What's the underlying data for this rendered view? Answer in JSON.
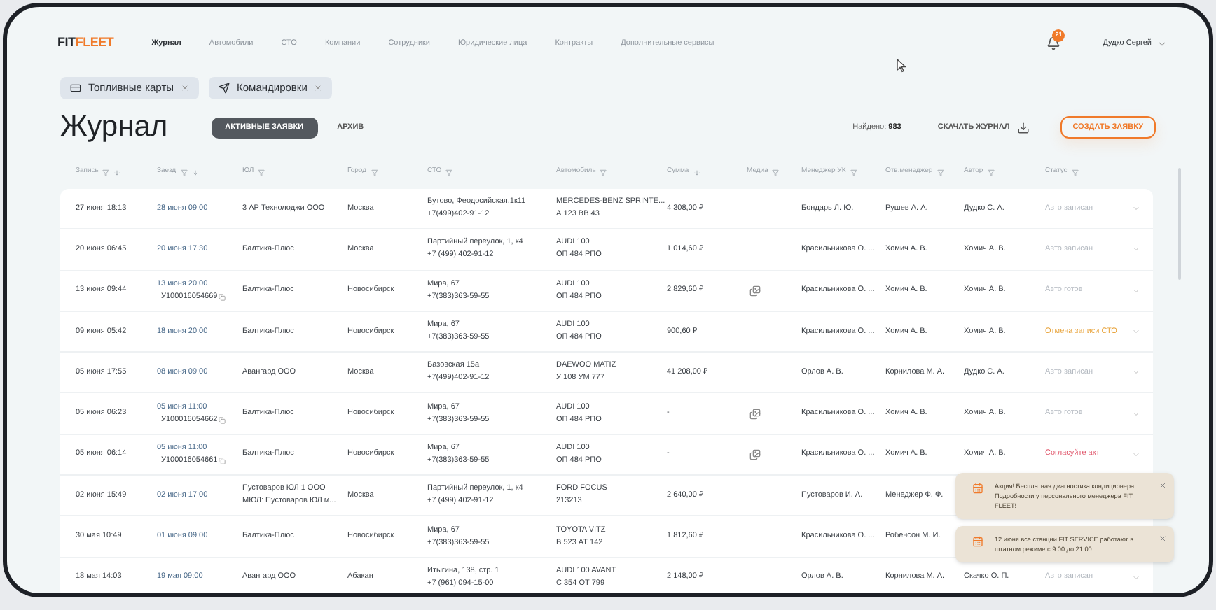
{
  "logo": {
    "part_1": "FIT",
    "part_2": "FLEET"
  },
  "nav": [
    {
      "label": "Журнал",
      "selected": true
    },
    {
      "label": "Автомобили",
      "selected": false
    },
    {
      "label": "СТО",
      "selected": false
    },
    {
      "label": "Компании",
      "selected": false
    },
    {
      "label": "Сотрудники",
      "selected": false
    },
    {
      "label": "Юридические лица",
      "selected": false
    },
    {
      "label": "Контракты",
      "selected": false
    },
    {
      "label": "Дополнительные сервисы",
      "selected": false
    }
  ],
  "notifications": {
    "count": "21"
  },
  "user": {
    "name": "Дудко Сергей"
  },
  "chips": [
    {
      "kind": "card",
      "label": "Топливные карты"
    },
    {
      "kind": "plane",
      "label": "Командировки"
    }
  ],
  "title": "Журнал",
  "tabs": [
    {
      "label": "АКТИВНЫЕ ЗАЯВКИ",
      "selected": true
    },
    {
      "label": "АРХИВ",
      "selected": false
    }
  ],
  "found": {
    "label": "Найдено:",
    "value": "983"
  },
  "download": {
    "label": "СКАЧАТЬ ЖУРНАЛ"
  },
  "create": {
    "label": "СОЗДАТЬ ЗАЯВКУ"
  },
  "columns": [
    {
      "label": "Запись",
      "filter": true,
      "sort": true
    },
    {
      "label": "Заезд",
      "filter": true,
      "sort": true
    },
    {
      "label": "ЮЛ",
      "filter": true,
      "sort": false
    },
    {
      "label": "Город",
      "filter": true,
      "sort": false
    },
    {
      "label": "СТО",
      "filter": true,
      "sort": false
    },
    {
      "label": "Автомобиль",
      "filter": true,
      "sort": false
    },
    {
      "label": "Сумма",
      "filter": false,
      "sort": true
    },
    {
      "label": "Медиа",
      "filter": true,
      "sort": false
    },
    {
      "label": "Менеджер УК",
      "filter": true,
      "sort": false
    },
    {
      "label": "Отв.менеджер",
      "filter": true,
      "sort": false
    },
    {
      "label": "Автор",
      "filter": true,
      "sort": false
    },
    {
      "label": "Статус",
      "filter": true,
      "sort": false
    }
  ],
  "rows": [
    {
      "record": "27 июня 18:13",
      "arrival": "28 июня 09:00",
      "legal": [
        "3 АР Технолоджи ООО"
      ],
      "city": "Москва",
      "station": "Бутово, Феодосийская,1к11",
      "station_phone": "+7(499)402-91-12",
      "car": "MERCEDES-BENZ SPRINTE...",
      "plate": "А 123 ВВ 43",
      "sum": "4 308,00 ₽",
      "media": false,
      "manager": "Бондарь Л. Ю.",
      "resp": "Рушев А. А.",
      "author": "Дудко С. А.",
      "status": {
        "text": "Авто записан",
        "kind": "muted"
      }
    },
    {
      "record": "20 июня 06:45",
      "arrival": "20 июня 17:30",
      "legal": [
        "Балтика-Плюс"
      ],
      "city": "Москва",
      "station": "Партийный переулок, 1, к4",
      "station_phone": "+7 (499) 402-91-12",
      "car": "AUDI 100",
      "plate": "ОП 484 РПО",
      "sum": "1 014,60 ₽",
      "media": false,
      "manager": "Красильникова О. ...",
      "resp": "Хомич А. В.",
      "author": "Хомич А. В.",
      "status": {
        "text": "Авто записан",
        "kind": "muted"
      }
    },
    {
      "record": "13 июня 09:44",
      "arrival": "13 июня 20:00",
      "code": "У100016054669",
      "legal": [
        "Балтика-Плюс"
      ],
      "city": "Новосибирск",
      "station": "Мира, 67",
      "station_phone": "+7(383)363-59-55",
      "car": "AUDI 100",
      "plate": "ОП 484 РПО",
      "sum": "2 829,60 ₽",
      "media": true,
      "manager": "Красильникова О. ...",
      "resp": "Хомич А. В.",
      "author": "Хомич А. В.",
      "status": {
        "text": "Авто готов",
        "kind": "muted"
      }
    },
    {
      "record": "09 июня 05:42",
      "arrival": "18 июня 20:00",
      "legal": [
        "Балтика-Плюс"
      ],
      "city": "Новосибирск",
      "station": "Мира, 67",
      "station_phone": "+7(383)363-59-55",
      "car": "AUDI 100",
      "plate": "ОП 484 РПО",
      "sum": "900,60 ₽",
      "media": false,
      "manager": "Красильникова О. ...",
      "resp": "Хомич А. В.",
      "author": "Хомич А. В.",
      "status": {
        "text": "Отмена записи СТО",
        "kind": "warning"
      }
    },
    {
      "record": "05 июня 17:55",
      "arrival": "08 июня 09:00",
      "legal": [
        "Авангард ООО"
      ],
      "city": "Москва",
      "station": "Базовская 15а",
      "station_phone": "+7(499)402-91-12",
      "car": "DAEWOO MATIZ",
      "plate": "У 108 УМ 777",
      "sum": "41 208,00 ₽",
      "media": false,
      "manager": "Орлов А. В.",
      "resp": "Корнилова М. А.",
      "author": "Дудко С. А.",
      "status": {
        "text": "Авто записан",
        "kind": "muted"
      }
    },
    {
      "record": "05 июня 06:23",
      "arrival": "05 июня 11:00",
      "code": "У100016054662",
      "legal": [
        "Балтика-Плюс"
      ],
      "city": "Новосибирск",
      "station": "Мира, 67",
      "station_phone": "+7(383)363-59-55",
      "car": "AUDI 100",
      "plate": "ОП 484 РПО",
      "sum": "-",
      "media": true,
      "manager": "Красильникова О. ...",
      "resp": "Хомич А. В.",
      "author": "Хомич А. В.",
      "status": {
        "text": "Авто готов",
        "kind": "muted"
      }
    },
    {
      "record": "05 июня 06:14",
      "arrival": "05 июня 11:00",
      "code": "У100016054661",
      "legal": [
        "Балтика-Плюс"
      ],
      "city": "Новосибирск",
      "station": "Мира, 67",
      "station_phone": "+7(383)363-59-55",
      "car": "AUDI 100",
      "plate": "ОП 484 РПО",
      "sum": "-",
      "media": true,
      "manager": "Красильникова О. ...",
      "resp": "Хомич А. В.",
      "author": "Хомич А. В.",
      "status": {
        "text": "Согласуйте акт",
        "kind": "danger"
      }
    },
    {
      "record": "02 июня 15:49",
      "arrival": "02 июня 17:00",
      "legal": [
        "Пустоваров ЮЛ 1 ООО",
        "МЮЛ: Пустоваров ЮЛ м..."
      ],
      "city": "Москва",
      "station": "Партийный переулок, 1, к4",
      "station_phone": "+7 (499) 402-91-12",
      "car": "FORD FOCUS",
      "plate": "213213",
      "sum": "2 640,00 ₽",
      "media": false,
      "manager": "Пустоваров И. А.",
      "resp": "Менеджер Ф. Ф."
    },
    {
      "record": "30 мая 10:49",
      "arrival": "01 июня 09:00",
      "legal": [
        "Балтика-Плюс"
      ],
      "city": "Новосибирск",
      "station": "Мира, 67",
      "station_phone": "+7(383)363-59-55",
      "car": "TOYOTA VITZ",
      "plate": "В 523 АТ 142",
      "sum": "1 812,60 ₽",
      "media": false,
      "manager": "Красильникова О. ...",
      "resp": "Робенсон М. И."
    },
    {
      "record": "18 мая 14:03",
      "arrival": "19 мая 09:00",
      "legal": [
        "Авангард ООО"
      ],
      "city": "Абакан",
      "station": "Итыгина, 138, стр. 1",
      "station_phone": "+7 (961) 094-15-00",
      "car": "AUDI 100 AVANT",
      "plate": "С 354 ОТ 799",
      "sum": "2 148,00 ₽",
      "media": false,
      "manager": "Орлов А. В.",
      "resp": "Корнилова М. А.",
      "author": "Скачко О. П.",
      "status": {
        "text": "Авто записан",
        "kind": "muted"
      }
    }
  ],
  "toasts": [
    {
      "text": "Акция! Бесплатная диагностика кондиционера! Подробности у персонального менеджера FIT FLEET!"
    },
    {
      "text": "12 июня все станции FIT SERVICE работают в штатном режиме с 9.00 до 21.00."
    }
  ]
}
